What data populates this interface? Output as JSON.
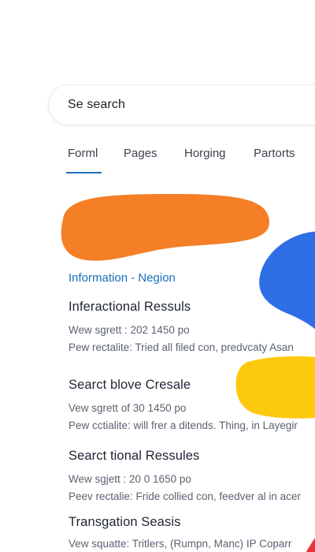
{
  "search": {
    "query": "Se search"
  },
  "tabs": [
    {
      "label": "Forml",
      "active": true
    },
    {
      "label": "Pages",
      "active": false
    },
    {
      "label": "Horging",
      "active": false
    },
    {
      "label": "Partorts",
      "active": false
    }
  ],
  "section_label": "Information - Negion",
  "results": [
    {
      "title": "Inferactional Ressuls",
      "meta": "Wew sgrett : 202 1450 po",
      "desc": "Pew rectalite: Tried all filed con, predvcaty Asan"
    },
    {
      "title": "Searct blove Cresale",
      "meta": "Vew sgrett of 30 1450 po",
      "desc": "Pew cctialite: will frer a ditends. Thing, in Layegir"
    },
    {
      "title": "Searct tional Ressules",
      "meta": "Wew sgjett : 20 0 1650 po",
      "desc": "Peev rectalie: Fride collied con, feedver al in acer"
    },
    {
      "title": "Transgation Seasis",
      "meta": "Vew squatte: Tritlers, (Rumpn, Manc) IP Coparr",
      "desc": ""
    }
  ],
  "colors": {
    "accent": "#1a6fb8",
    "orange": "#f47f26",
    "blue": "#2f6fe6",
    "yellow": "#fdc90d",
    "red": "#e8323c"
  }
}
